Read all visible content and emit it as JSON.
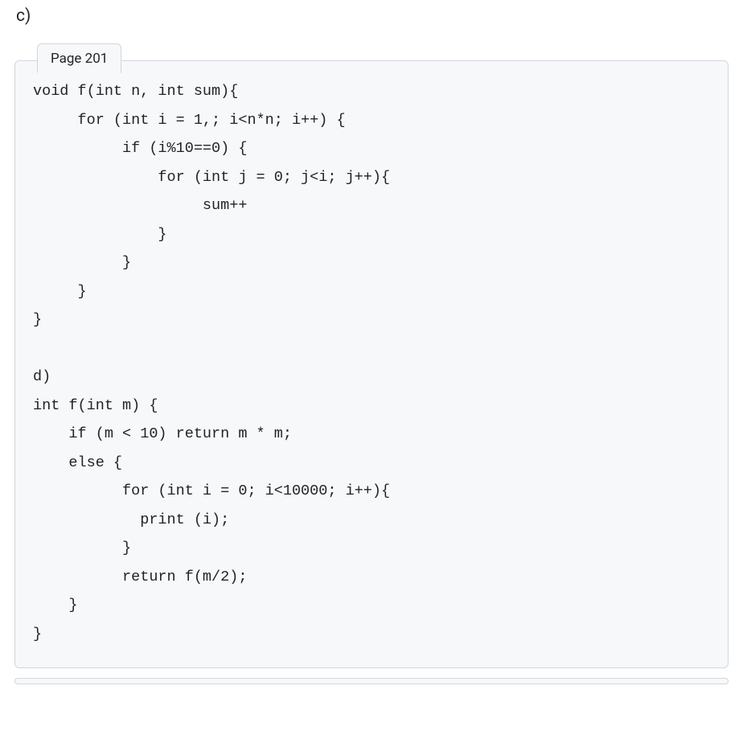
{
  "heading": "c)",
  "tab_label": "Page 201",
  "code": "void f(int n, int sum){\n     for (int i = 1,; i<n*n; i++) {\n          if (i%10==0) {\n              for (int j = 0; j<i; j++){\n                   sum++\n              }\n          }\n     }\n}\n\nd)\nint f(int m) {\n    if (m < 10) return m * m;\n    else {\n          for (int i = 0; i<10000; i++){\n            print (i);\n          }\n          return f(m/2);\n    }\n}"
}
